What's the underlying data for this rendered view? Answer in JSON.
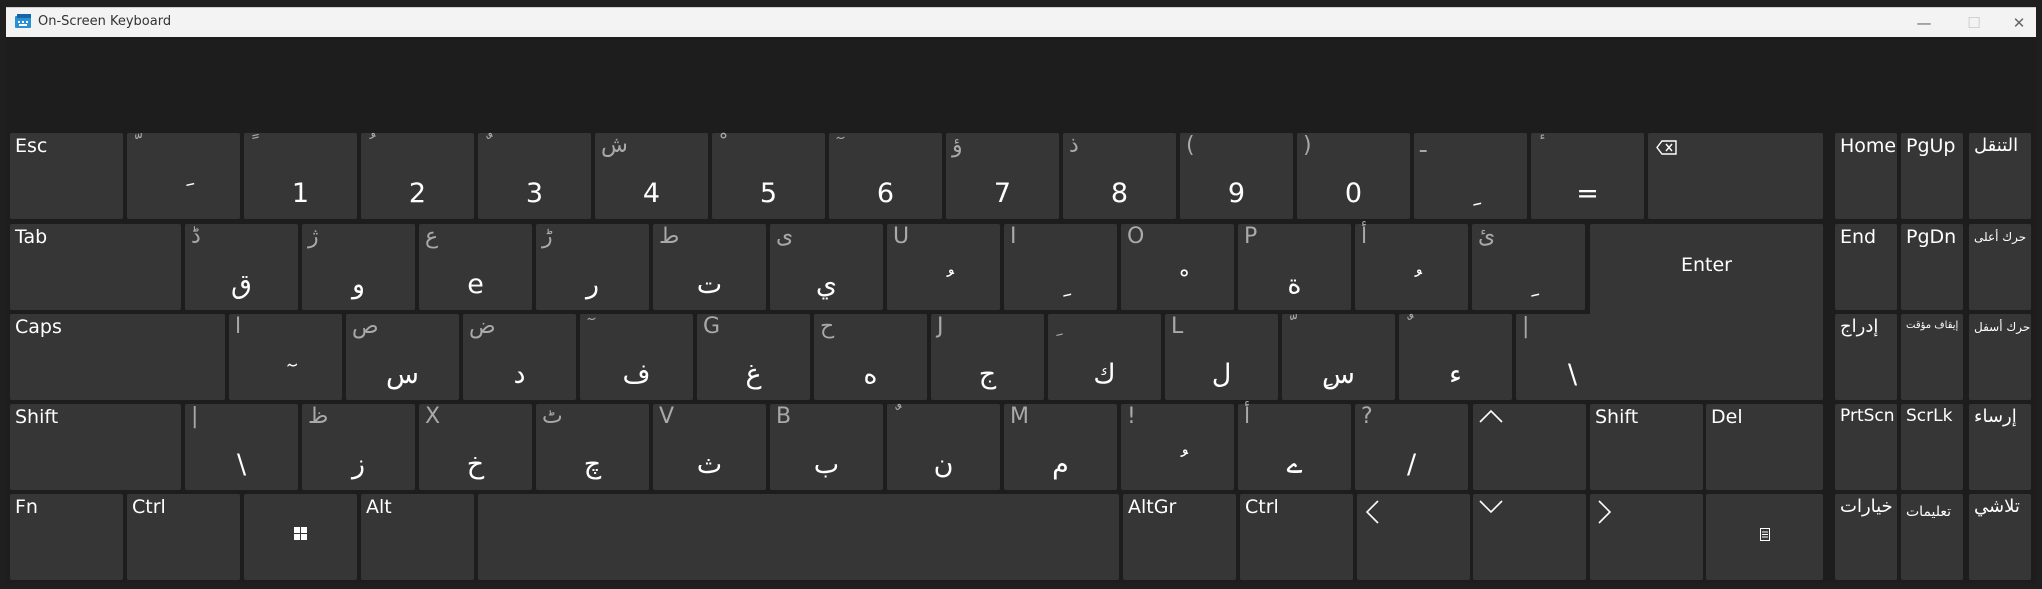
{
  "window": {
    "title": "On-Screen Keyboard",
    "minimize_glyph": "—",
    "maximize_glyph": "☐",
    "close_glyph": "✕"
  },
  "colors": {
    "background": "#1f1f1f",
    "key": "#363636",
    "key_text": "#ffffff",
    "shift_text": "#a9a9a9",
    "titlebar": "#f3f3f3"
  },
  "keys": {
    "esc": "Esc",
    "tab": "Tab",
    "caps": "Caps",
    "shift_left": "Shift",
    "shift_right": "Shift",
    "fn": "Fn",
    "ctrl_left": "Ctrl",
    "ctrl_right": "Ctrl",
    "alt": "Alt",
    "altgr": "AltGr",
    "enter": "Enter",
    "del": "Del",
    "home": "Home",
    "pgup": "PgUp",
    "end": "End",
    "pgdn": "PgDn",
    "prtscn": "PrtScn",
    "scrlk": "ScrLk",
    "nav": "التنقل",
    "move_up": "حرك أعلى",
    "move_down": "حرك أسفل",
    "insert": "إدراج",
    "pause": "إيقاف مؤقت",
    "dock": "إرساء",
    "options": "خيارات",
    "help": "تعليمات",
    "fade": "تلاشي",
    "backspace_icon": "backspace-icon",
    "windows_icon": "windows-logo-icon",
    "menu_icon": "context-menu-icon"
  },
  "row1": [
    {
      "shift": "ّ",
      "main": "َ"
    },
    {
      "shift": "ً",
      "main": "1"
    },
    {
      "shift": "ُ",
      "main": "2"
    },
    {
      "shift": "ٌ",
      "main": "3"
    },
    {
      "shift": "ش",
      "main": "4"
    },
    {
      "shift": "ْ",
      "main": "5"
    },
    {
      "shift": "ٓ",
      "main": "6"
    },
    {
      "shift": "ؤ",
      "main": "7"
    },
    {
      "shift": "ذ",
      "main": "8"
    },
    {
      "shift": "(",
      "main": "9"
    },
    {
      "shift": ")",
      "main": "0"
    },
    {
      "shift": "ـ",
      "main": "ِ"
    },
    {
      "shift": "ٔ",
      "main": "="
    }
  ],
  "row2": [
    {
      "shift": "ڈ",
      "main": "ق"
    },
    {
      "shift": "ژ",
      "main": "و"
    },
    {
      "shift": "ع",
      "main": "e"
    },
    {
      "shift": "ڑ",
      "main": "ر"
    },
    {
      "shift": "ط",
      "main": "ت"
    },
    {
      "shift": "ی",
      "main": "ي"
    },
    {
      "shift": "U",
      "main": "ُ"
    },
    {
      "shift": "I",
      "main": "ِ"
    },
    {
      "shift": "O",
      "main": "ْ"
    },
    {
      "shift": "P",
      "main": "ة"
    },
    {
      "shift": "أ",
      "main": "ُ"
    },
    {
      "shift": "ئ",
      "main": "ِ"
    }
  ],
  "row3": [
    {
      "shift": "ا",
      "main": "ٓ"
    },
    {
      "shift": "ص",
      "main": "س"
    },
    {
      "shift": "ض",
      "main": "د"
    },
    {
      "shift": "ٓ",
      "main": "ف"
    },
    {
      "shift": "G",
      "main": "غ"
    },
    {
      "shift": "ح",
      "main": "ه"
    },
    {
      "shift": "J",
      "main": "ج"
    },
    {
      "shift": "ِ",
      "main": "ك"
    },
    {
      "shift": "L",
      "main": "ل"
    },
    {
      "shift": "ّ",
      "main": "ِس"
    },
    {
      "shift": "ٌ",
      "main": "ء"
    },
    {
      "shift": "|",
      "main": "\\"
    }
  ],
  "row4": [
    {
      "shift": "|",
      "main": "\\"
    },
    {
      "shift": "ظ",
      "main": "ز"
    },
    {
      "shift": "X",
      "main": "خ"
    },
    {
      "shift": "ٹ",
      "main": "چ"
    },
    {
      "shift": "V",
      "main": "ث"
    },
    {
      "shift": "B",
      "main": "ب"
    },
    {
      "shift": "ٌ",
      "main": "ن"
    },
    {
      "shift": "M",
      "main": "م"
    },
    {
      "shift": "!",
      "main": "ُ"
    },
    {
      "shift": "أ",
      "main": "ے"
    },
    {
      "shift": "?",
      "main": "/"
    }
  ]
}
